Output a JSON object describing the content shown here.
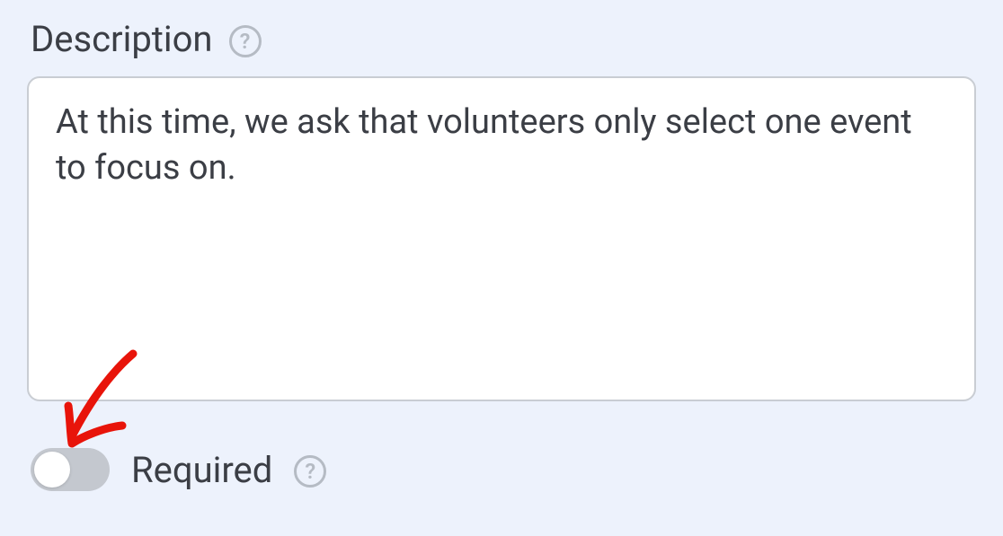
{
  "field": {
    "description_label": "Description",
    "description_value": "At this time, we ask that volunteers only select one event to focus on.",
    "required_label": "Required",
    "required_state": false
  },
  "icons": {
    "help_glyph": "?"
  },
  "annotation": {
    "color": "#e8140a"
  }
}
